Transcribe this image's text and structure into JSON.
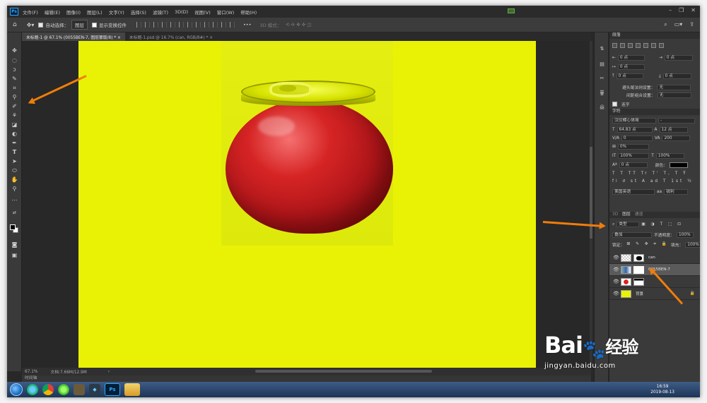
{
  "menu": {
    "items": [
      "文件(F)",
      "编辑(E)",
      "图像(I)",
      "图层(L)",
      "文字(Y)",
      "选择(S)",
      "滤镜(T)",
      "3D(D)",
      "视图(V)",
      "窗口(W)",
      "帮助(H)"
    ]
  },
  "options": {
    "auto_select_label": "自动选择：",
    "auto_select_target": "图层",
    "show_transform_label": "显示变换控件",
    "mode_3d_label": "3D 模式："
  },
  "tabs": [
    {
      "label": "未标题-1 @ 67.1% (0055BEN-7, 图层蒙版/8) *"
    },
    {
      "label": "未标题-1.psd @ 16.7% (can, RGB/8#) *"
    }
  ],
  "status": {
    "zoom": "67.1%",
    "doc_size": "文档:7.66M/12.9M",
    "timeline": "时间轴"
  },
  "paragraph_panel": {
    "title": "段落",
    "indent_left": "0 点",
    "indent_right": "0 点",
    "indent_first": "0 点",
    "space_before": "0 点",
    "space_after": "0 点",
    "kinsoku_label": "避头尾法则设置：",
    "kinsoku_value": "无",
    "mojikumi_label": "间距组合设置：",
    "mojikumi_value": "无",
    "hyphenate_label": "连字"
  },
  "character_panel": {
    "title": "字符",
    "font_family": "汉仪蝶心体简",
    "font_style": "-",
    "font_size": "64.83 点",
    "leading": "12 点",
    "kerning": "0",
    "tracking": "200",
    "scale_h": "0%",
    "scale_v": "100%",
    "scale_v2": "100%",
    "baseline": "0 点",
    "color_label": "颜色：",
    "language": "美国英语",
    "aa": "锐利"
  },
  "layers_panel": {
    "tabs": [
      "3D",
      "图层",
      "通道"
    ],
    "filter_kind": "类型",
    "blend_mode": "叠加",
    "opacity_label": "不透明度：",
    "opacity": "100%",
    "lock_label": "锁定：",
    "fill_label": "填充：",
    "fill": "100%",
    "layers": [
      {
        "name": "can",
        "selected": false
      },
      {
        "name": "0055BEN-7",
        "selected": true
      },
      {
        "name": "",
        "selected": false
      },
      {
        "name": "背景",
        "selected": false
      }
    ]
  },
  "taskbar": {
    "time": "16:59",
    "date": "2019-08-13"
  },
  "watermark": {
    "logo_text": "Bai",
    "logo_text2": "经验",
    "url": "jingyan.baidu.com"
  },
  "colors": {
    "canvas": "#e9f205",
    "accent_arrow": "#f07d0a"
  }
}
